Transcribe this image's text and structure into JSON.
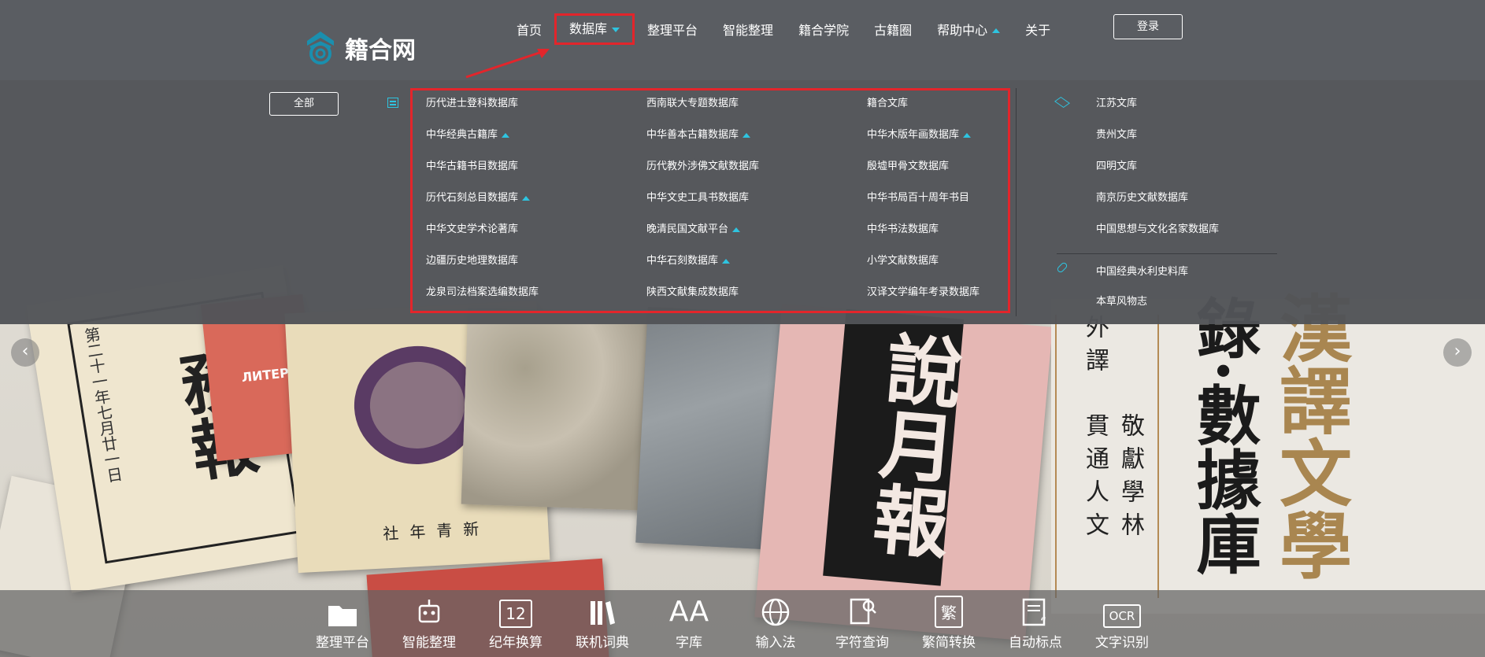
{
  "header": {
    "logo_text": "籍合网",
    "nav": [
      {
        "label": "首页"
      },
      {
        "label": "数据库",
        "caret": "down",
        "active": true
      },
      {
        "label": "整理平台"
      },
      {
        "label": "智能整理"
      },
      {
        "label": "籍合学院"
      },
      {
        "label": "古籍圈"
      },
      {
        "label": "帮助中心",
        "caret": "up"
      },
      {
        "label": "关于"
      }
    ],
    "login_label": "登录"
  },
  "dropdown": {
    "all_label": "全部",
    "databases": [
      {
        "label": "历代进士登科数据库"
      },
      {
        "label": "西南联大专题数据库"
      },
      {
        "label": "籍合文库"
      },
      {
        "label": "中华经典古籍库",
        "caret": "up"
      },
      {
        "label": "中华善本古籍数据库",
        "caret": "up"
      },
      {
        "label": "中华木版年画数据库",
        "caret": "up"
      },
      {
        "label": "中华古籍书目数据库"
      },
      {
        "label": "历代教外涉佛文献数据库"
      },
      {
        "label": "殷墟甲骨文数据库"
      },
      {
        "label": "历代石刻总目数据库",
        "caret": "up"
      },
      {
        "label": "中华文史工具书数据库"
      },
      {
        "label": "中华书局百十周年书目"
      },
      {
        "label": "中华文史学术论著库"
      },
      {
        "label": "晚清民国文献平台",
        "caret": "up"
      },
      {
        "label": "中华书法数据库"
      },
      {
        "label": "边疆历史地理数据库"
      },
      {
        "label": "中华石刻数据库",
        "caret": "up"
      },
      {
        "label": "小学文献数据库"
      },
      {
        "label": "龙泉司法档案选编数据库"
      },
      {
        "label": "陕西文献集成数据库"
      },
      {
        "label": "汉译文学编年考录数据库"
      }
    ],
    "libraries": [
      {
        "label": "江苏文库"
      },
      {
        "label": "贵州文库"
      },
      {
        "label": "四明文库"
      },
      {
        "label": "南京历史文献数据库"
      },
      {
        "label": "中国思想与文化名家数据库"
      }
    ],
    "links": [
      {
        "label": "中国经典水利史料库"
      },
      {
        "label": "本草风物志"
      }
    ]
  },
  "banner": {
    "mag1_title": "務報",
    "mag1_side": "第二十一年七月廿一日",
    "mag2_title": "ЛИТЕРАТУ",
    "mag3_label": "社年青新",
    "mag6_title": "說月報",
    "panel_col1": "外譯",
    "panel_col2": "貫通人文",
    "panel_col3": "敬獻學林",
    "panel_big": "錄·數據庫",
    "panel_gold": "漢譯文學"
  },
  "toolbar": {
    "tools": [
      {
        "label": "整理平台",
        "icon": "folder-icon"
      },
      {
        "label": "智能整理",
        "icon": "robot-icon"
      },
      {
        "label": "纪年换算",
        "icon": "calendar-icon",
        "glyph": "12"
      },
      {
        "label": "联机词典",
        "icon": "books-icon"
      },
      {
        "label": "字库",
        "icon": "font-icon",
        "glyph": "AA"
      },
      {
        "label": "输入法",
        "icon": "globe-icon"
      },
      {
        "label": "字符查询",
        "icon": "document-search-icon"
      },
      {
        "label": "繁简转换",
        "icon": "convert-icon",
        "glyph": "繁"
      },
      {
        "label": "自动标点",
        "icon": "quote-document-icon"
      },
      {
        "label": "文字识别",
        "icon": "ocr-icon",
        "glyph": "OCR"
      }
    ]
  },
  "colors": {
    "accent": "#2ec4e0",
    "highlight": "#e3252b",
    "nav_bg": "#5a5d62"
  }
}
